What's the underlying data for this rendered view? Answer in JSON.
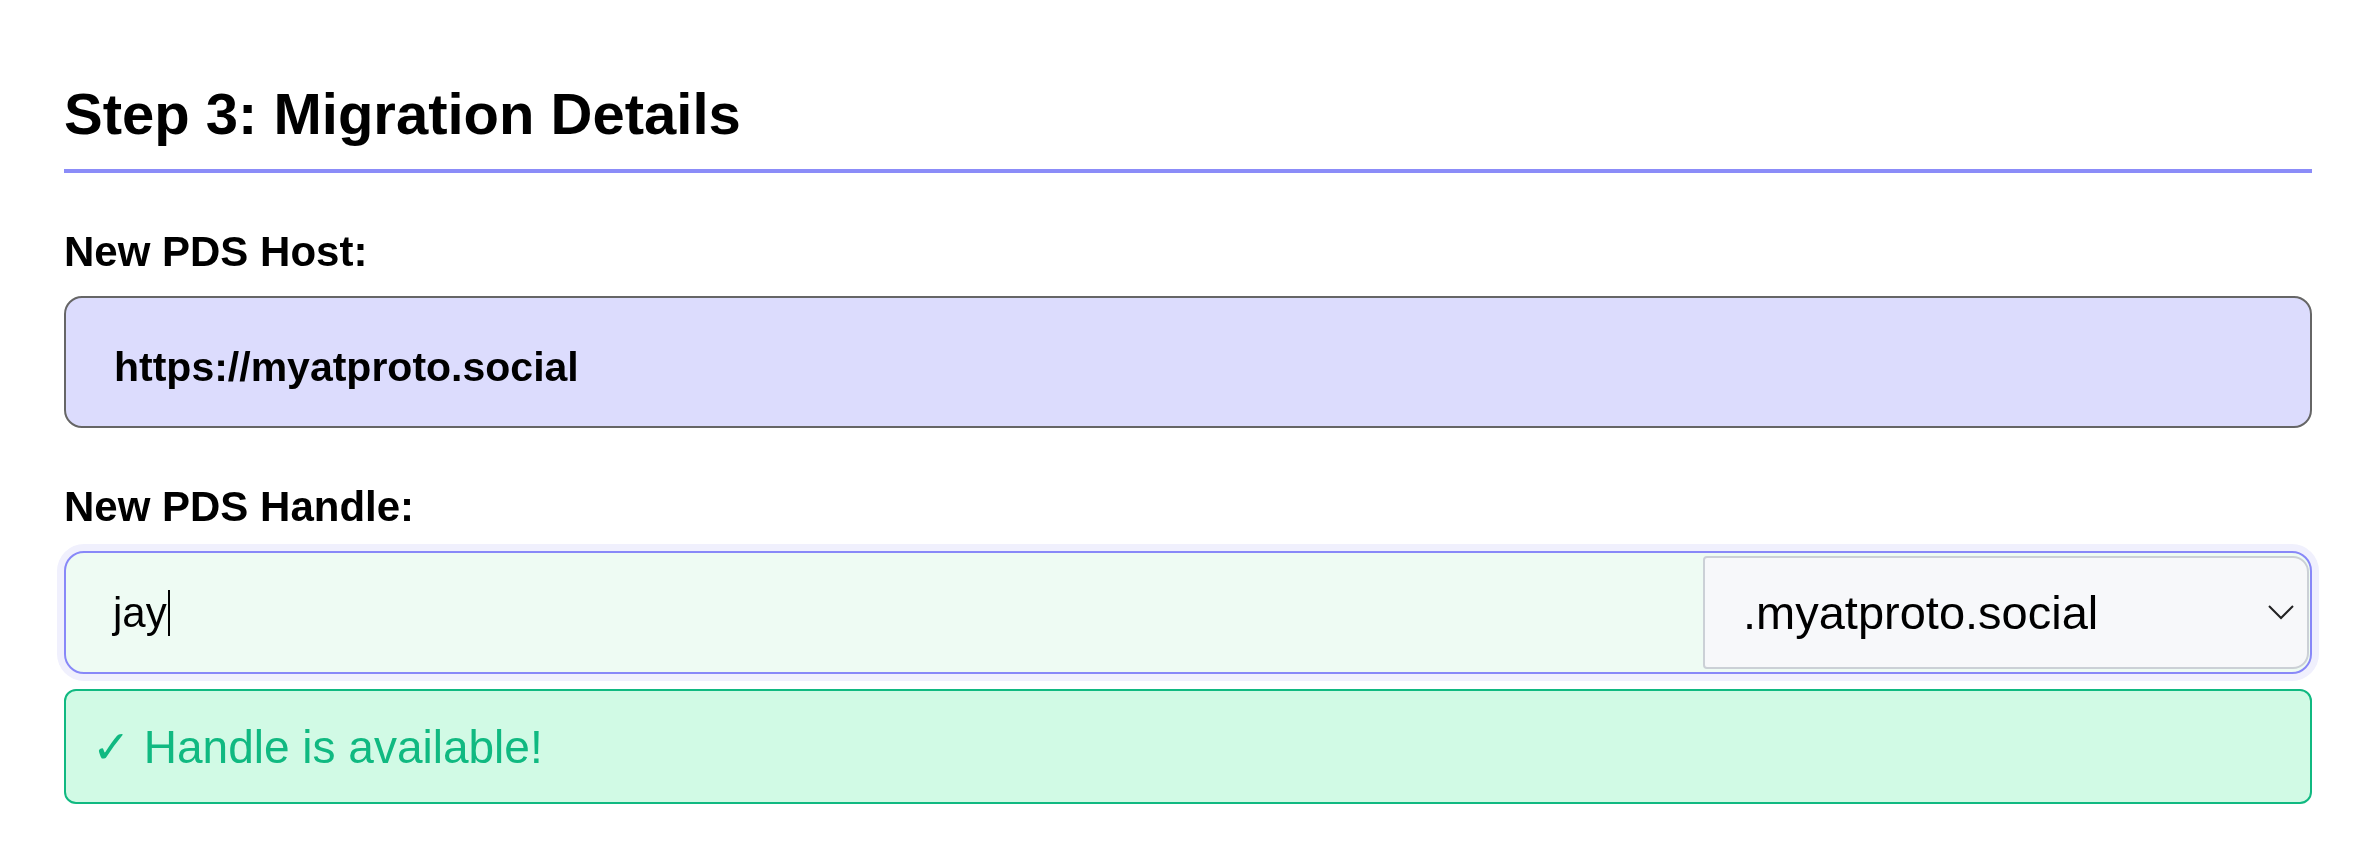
{
  "section": {
    "title": "Step 3: Migration Details"
  },
  "fields": [
    {
      "kind": "text",
      "label": "New PDS Host:",
      "value": "https://myatproto.social",
      "focused": false
    },
    {
      "kind": "handle",
      "label": "New PDS Handle:",
      "value": "jay",
      "suffix": ".myatproto.social",
      "focused": true
    }
  ],
  "status": {
    "kind": "success",
    "message": "✓ Handle is available!"
  }
}
